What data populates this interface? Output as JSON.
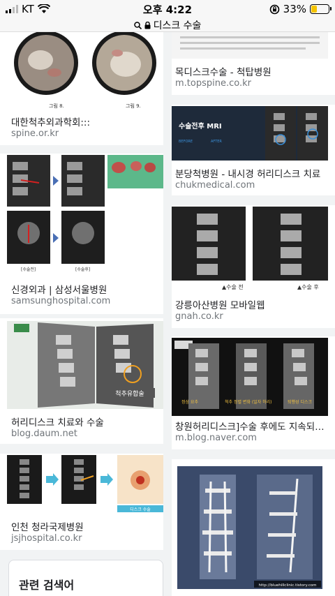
{
  "status": {
    "carrier": "KT",
    "time": "오후 4:22",
    "battery_pct": "33%",
    "battery_level": 0.33
  },
  "address": {
    "query": "디스크 수술"
  },
  "results_left": [
    {
      "title": "대한척추외과학회:::",
      "domain": "spine.or.kr",
      "captions": [
        "그림 8.",
        "그림 9."
      ]
    },
    {
      "title": "신경외과 | 삼성서울병원",
      "domain": "samsunghospital.com"
    },
    {
      "title": "허리디스크 치료와 수술",
      "domain": "blog.daum.net",
      "image_text": "척추유합술"
    },
    {
      "title": "인천 청라국제병원",
      "domain": "jsjhospital.co.kr",
      "image_text": "디스크 수술"
    }
  ],
  "results_right": [
    {
      "title": "목디스크수술 - 척탑병원",
      "domain": "m.topspine.co.kr"
    },
    {
      "title": "분당척병원 - 내시경 허리디스크 치료",
      "domain": "chukmedical.com",
      "image_text": "수술전후 MRI",
      "before_label": "BEFORE",
      "after_label": "AFTER"
    },
    {
      "title": "강릉아산병원 모바일웹",
      "domain": "gnah.co.kr",
      "captions": [
        "▲수술 전",
        "▲수술 후"
      ]
    },
    {
      "title": "창원허리디스크]수술 후에도 지속되는 ...",
      "domain": "m.blog.naver.com",
      "captions": [
        "정상 요추",
        "척추 정렬 변화 (일자 허리)",
        "퇴행성 디스크"
      ]
    },
    {
      "image_text": "http://bluehillclinic.tistory.com"
    }
  ],
  "related": {
    "title": "관련 검색어"
  },
  "colors": {
    "battery": "#f5c400",
    "domain": "#70757a",
    "title": "#202124",
    "arrow": "#4ab8d8"
  }
}
